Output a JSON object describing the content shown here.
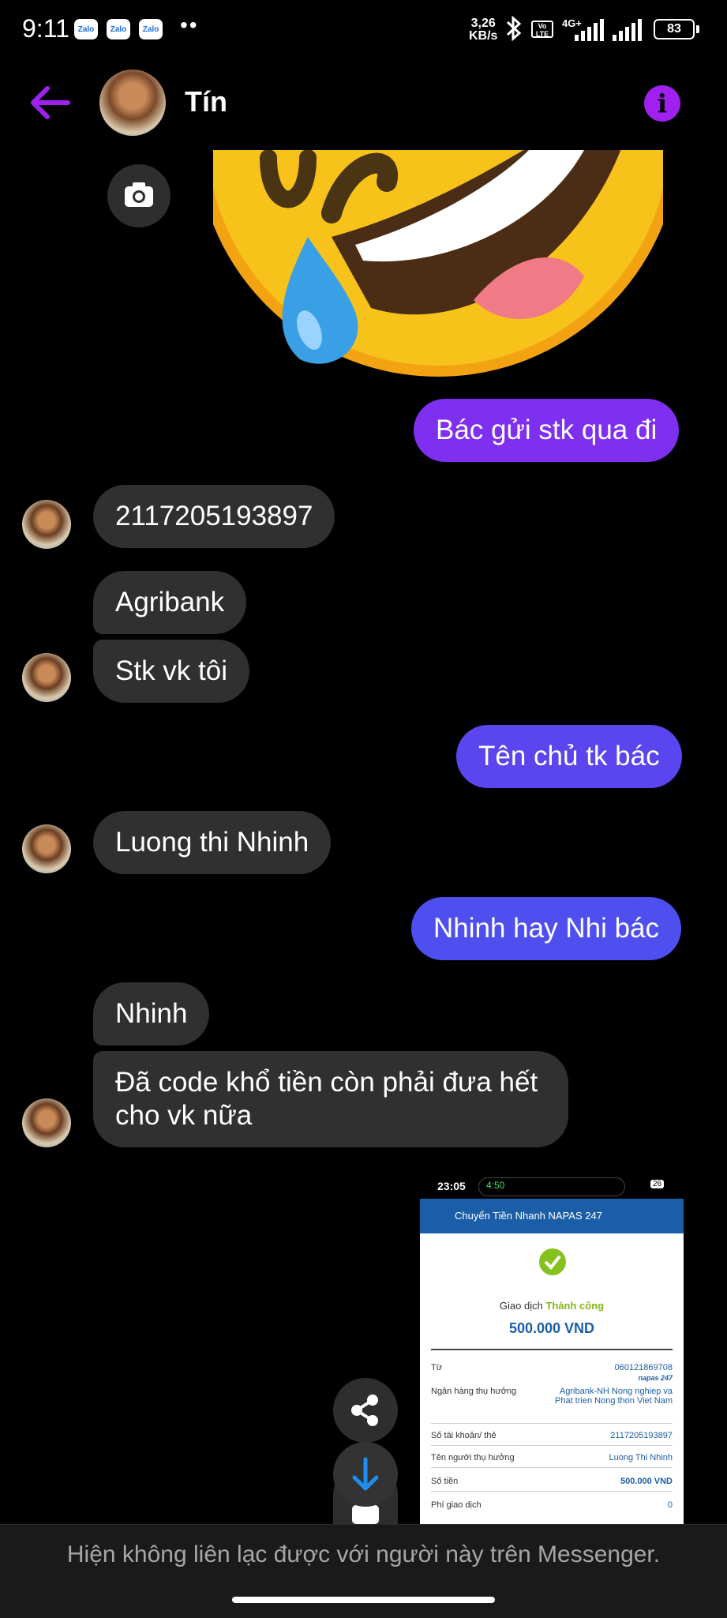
{
  "status_bar": {
    "time": "9:11",
    "notif_apps": [
      "Zalo",
      "Zalo",
      "Zalo"
    ],
    "more": "••",
    "speed_value": "3,26",
    "speed_unit": "KB/s",
    "volte": "Vo LTE",
    "network": "4G+",
    "battery": "83"
  },
  "header": {
    "contact_name": "Tín",
    "back_icon": "arrow-left-icon",
    "info_icon": "info-icon",
    "info_glyph": "i",
    "accent_color": "#a020f0"
  },
  "messages": [
    {
      "side": "out",
      "text": "Bác gửi stk qua đi",
      "color": "#7f2ff0"
    },
    {
      "side": "in",
      "text": "2117205193897"
    },
    {
      "side": "in",
      "text": "Agribank"
    },
    {
      "side": "in",
      "text": "Stk vk tôi"
    },
    {
      "side": "out",
      "text": "Tên chủ tk bác",
      "color": "#5a45ee"
    },
    {
      "side": "in",
      "text": "Luong thi Nhinh"
    },
    {
      "side": "out",
      "text": "Nhinh hay Nhi bác",
      "color": "#4f4ff0"
    },
    {
      "side": "in",
      "text": "Nhinh"
    },
    {
      "side": "in",
      "text_line1": "Đã code khổ tiền còn phải đưa hết",
      "text_line2": "cho vk nữa"
    }
  ],
  "receipt": {
    "status_time": "23:05",
    "call_time": "4:50",
    "battery": "26",
    "title": "Chuyển Tiền Nhanh NAPAS 247",
    "result_label": "Giao dịch",
    "result_status": "Thành công",
    "amount": "500.000 VND",
    "rows": [
      {
        "label": "Từ",
        "value": "060121869708"
      },
      {
        "label": "",
        "value": "napas 247"
      },
      {
        "label": "Ngân hàng thụ hưởng",
        "value": "Agribank-NH Nong nghiep va Phat trien Nong thon Viet Nam"
      },
      {
        "label": "Số tài khoản/ thẻ",
        "value": "2117205193897"
      },
      {
        "label": "Tên người thụ hưởng",
        "value": "Luong Thi Nhinh"
      },
      {
        "label": "Số tiền",
        "value": "500.000 VND"
      },
      {
        "label": "Phí giao dịch",
        "value": "0"
      }
    ]
  },
  "footer": {
    "text": "Hiện không liên lạc được với người này trên Messenger."
  }
}
